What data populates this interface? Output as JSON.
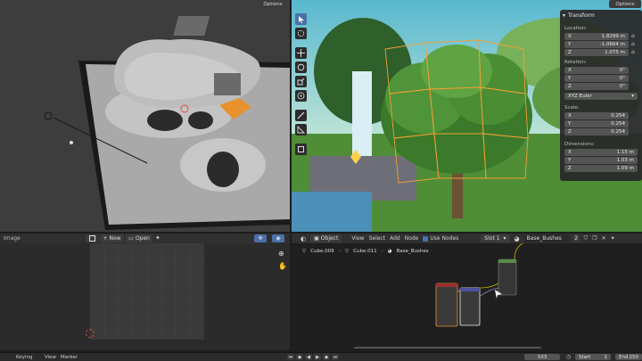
{
  "viewport_left": {
    "options_label": "Options"
  },
  "viewport_right": {
    "options_label": "Options"
  },
  "transform_panel": {
    "title": "Transform",
    "location_label": "Location:",
    "location": [
      {
        "axis": "X",
        "value": "1.8299 m"
      },
      {
        "axis": "Y",
        "value": "-1.0664 m"
      },
      {
        "axis": "Z",
        "value": "1.075 m"
      }
    ],
    "rotation_label": "Rotation:",
    "rotation": [
      {
        "axis": "X",
        "value": "0°"
      },
      {
        "axis": "Y",
        "value": "0°"
      },
      {
        "axis": "Z",
        "value": "0°"
      }
    ],
    "rotation_mode": "XYZ Euler",
    "scale_label": "Scale:",
    "scale": [
      {
        "axis": "X",
        "value": "0.254"
      },
      {
        "axis": "Y",
        "value": "0.254"
      },
      {
        "axis": "Z",
        "value": "0.254"
      }
    ],
    "dimensions_label": "Dimensions:",
    "dimensions": [
      {
        "axis": "X",
        "value": "1.15 m"
      },
      {
        "axis": "Y",
        "value": "1.03 m"
      },
      {
        "axis": "Z",
        "value": "1.09 m"
      }
    ]
  },
  "image_editor": {
    "mode_label": "Image",
    "new_label": "New",
    "open_label": "Open"
  },
  "shader_editor": {
    "object_label": "Object",
    "menu": [
      "View",
      "Select",
      "Add",
      "Node"
    ],
    "use_nodes_label": "Use Nodes",
    "slot_label": "Slot 1",
    "material_name": "Base_Bushes",
    "material_users": "2",
    "breadcrumb": [
      "Cube.009",
      "Cube.011",
      "Base_Bushes"
    ]
  },
  "timeline": {
    "menu": [
      "Keying",
      "View",
      "Marker"
    ],
    "current_frame": "103",
    "start_label": "Start",
    "start_value": "1",
    "end_label": "End",
    "end_value": "250"
  },
  "colors": {
    "accent": "#4b70a8",
    "selection_orange": "#f2a036",
    "background": "#1d1d1d"
  }
}
